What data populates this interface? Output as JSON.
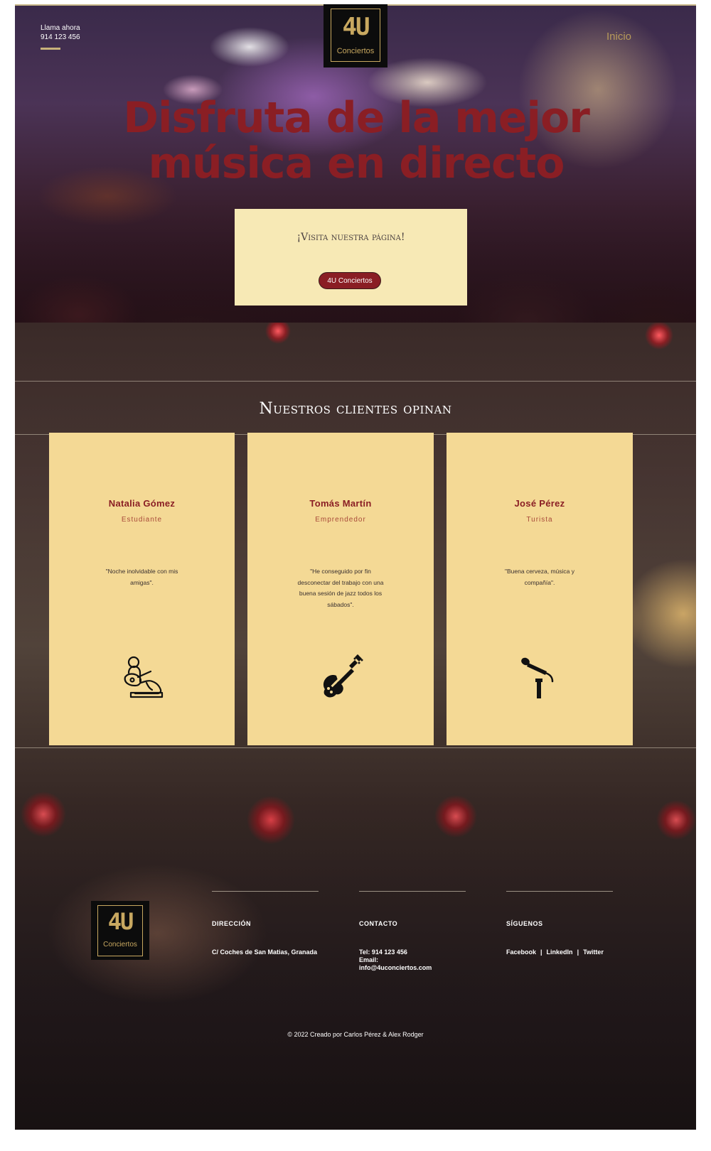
{
  "header": {
    "call_label": "Llama ahora",
    "phone": "914 123 456",
    "nav_inicio": "Inicio"
  },
  "logo": {
    "mark": "4U",
    "sub": "Conciertos"
  },
  "hero": {
    "title_line1": "Disfruta de la mejor",
    "title_line2": "música en directo",
    "cta_text": "¡Visita nuestra página!",
    "cta_button": "4U Conciertos"
  },
  "testimonials": {
    "title": "Nuestros clientes opinan",
    "items": [
      {
        "name": "Natalia Gómez",
        "role": "Estudiante",
        "quote": "\"Noche inolvidable con mis amigas\".",
        "icon": "guitarist-icon"
      },
      {
        "name": "Tomás Martín",
        "role": "Emprendedor",
        "quote": "\"He conseguido por fin desconectar del trabajo con una buena sesión de jazz todos los sábados\".",
        "icon": "electric-guitar-icon"
      },
      {
        "name": "José Pérez",
        "role": "Turista",
        "quote": "\"Buena cerveza, música y compañía\".",
        "icon": "microphone-icon"
      }
    ]
  },
  "footer": {
    "direccion_head": "DIRECCIÓN",
    "direccion_body": "C/ Coches de San Matias, Granada",
    "contacto_head": "CONTACTO",
    "tel": "Tel: 914 123 456",
    "email_label": "Email:",
    "email": "info@4uconciertos.com",
    "siguenos_head": "SÍGUENOS",
    "social": [
      "Facebook",
      "LinkedIn",
      "Twitter"
    ],
    "separator": "|",
    "copyright": "© 2022 Creado por Carlos Pérez & Alex Rodger"
  },
  "colors": {
    "accent": "#8a1e24",
    "card": "#f4d995",
    "cta_box": "#f7e9b5",
    "gold": "#c8a860"
  }
}
